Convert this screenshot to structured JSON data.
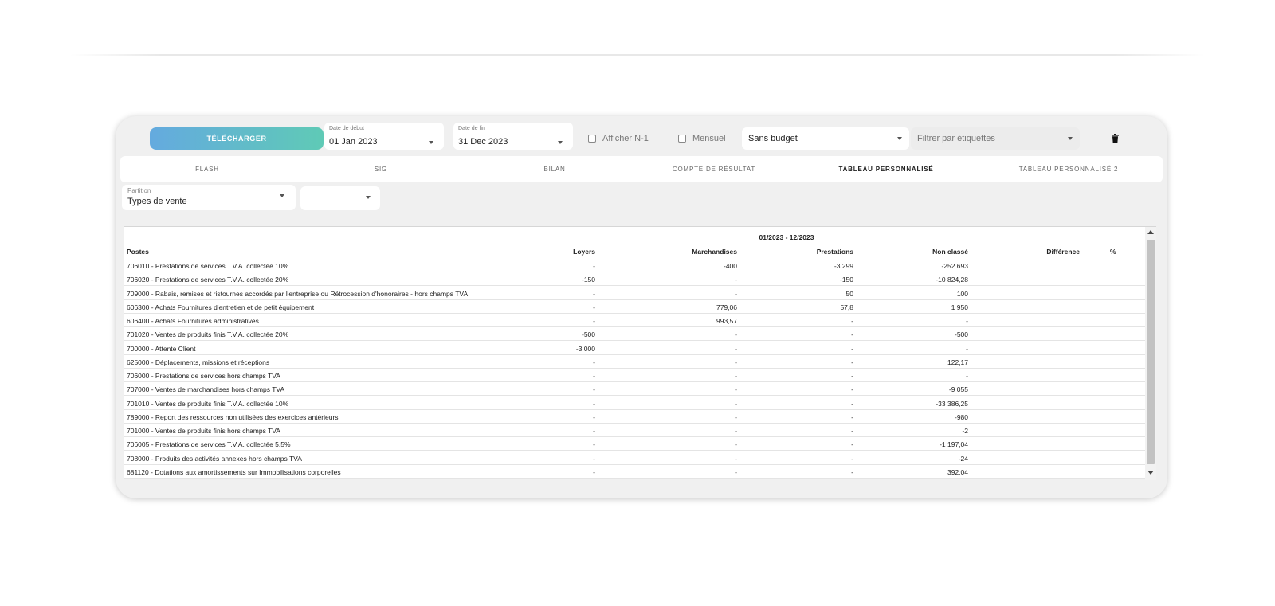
{
  "toolbar": {
    "download_label": "TÉLÉCHARGER",
    "start_date": {
      "label": "Date de début",
      "value": "01 Jan 2023"
    },
    "end_date": {
      "label": "Date de fin",
      "value": "31 Dec 2023"
    },
    "show_n1_label": "Afficher N-1",
    "monthly_label": "Mensuel",
    "budget_select": "Sans budget",
    "tags_filter_placeholder": "Filtrer par étiquettes"
  },
  "tabs": [
    {
      "label": "FLASH",
      "active": false
    },
    {
      "label": "SIG",
      "active": false
    },
    {
      "label": "BILAN",
      "active": false
    },
    {
      "label": "COMPTE DE RÉSULTAT",
      "active": false
    },
    {
      "label": "TABLEAU PERSONNALISÉ",
      "active": true
    },
    {
      "label": "TABLEAU PERSONNALISÉ 2",
      "active": false
    }
  ],
  "partition": {
    "label": "Partition",
    "value": "Types de vente",
    "secondary_value": ""
  },
  "table": {
    "period": "01/2023 - 12/2023",
    "columns": [
      "Postes",
      "Loyers",
      "Marchandises",
      "Prestations",
      "Non classé",
      "Différence",
      "%"
    ],
    "rows": [
      [
        "706010 - Prestations de services T.V.A. collectée 10%",
        "-",
        "-400",
        "-3 299",
        "-252 693",
        "",
        ""
      ],
      [
        "706020 - Prestations de services T.V.A. collectée 20%",
        "-150",
        "-",
        "-150",
        "-10 824,28",
        "",
        ""
      ],
      [
        "709000 - Rabais, remises et ristournes accordés par l'entreprise ou Rétrocession d'honoraires - hors champs TVA",
        "-",
        "-",
        "50",
        "100",
        "",
        ""
      ],
      [
        "606300 - Achats Fournitures d'entretien et de petit équipement",
        "-",
        "779,06",
        "57,8",
        "1 950",
        "",
        ""
      ],
      [
        "606400 - Achats Fournitures administratives",
        "-",
        "993,57",
        "-",
        "-",
        "",
        ""
      ],
      [
        "701020 - Ventes de produits finis T.V.A. collectée 20%",
        "-500",
        "-",
        "-",
        "-500",
        "",
        ""
      ],
      [
        "700000 - Attente Client",
        "-3 000",
        "-",
        "-",
        "-",
        "",
        ""
      ],
      [
        "625000 - Déplacements, missions et réceptions",
        "-",
        "-",
        "-",
        "122,17",
        "",
        ""
      ],
      [
        "706000 - Prestations de services hors champs TVA",
        "-",
        "-",
        "-",
        "-",
        "",
        ""
      ],
      [
        "707000 - Ventes de marchandises hors champs TVA",
        "-",
        "-",
        "-",
        "-9 055",
        "",
        ""
      ],
      [
        "701010 - Ventes de produits finis T.V.A. collectée 10%",
        "-",
        "-",
        "-",
        "-33 386,25",
        "",
        ""
      ],
      [
        "789000 - Report des ressources non utilisées des exercices antérieurs",
        "-",
        "-",
        "-",
        "-980",
        "",
        ""
      ],
      [
        "701000 - Ventes de produits finis hors champs TVA",
        "-",
        "-",
        "-",
        "-2",
        "",
        ""
      ],
      [
        "706005 - Prestations de services T.V.A. collectée 5.5%",
        "-",
        "-",
        "-",
        "-1 197,04",
        "",
        ""
      ],
      [
        "708000 - Produits des activités annexes hors champs TVA",
        "-",
        "-",
        "-",
        "-24",
        "",
        ""
      ],
      [
        "681120 - Dotations aux amortissements sur Immobilisations corporelles",
        "-",
        "-",
        "-",
        "392,04",
        "",
        ""
      ]
    ]
  }
}
